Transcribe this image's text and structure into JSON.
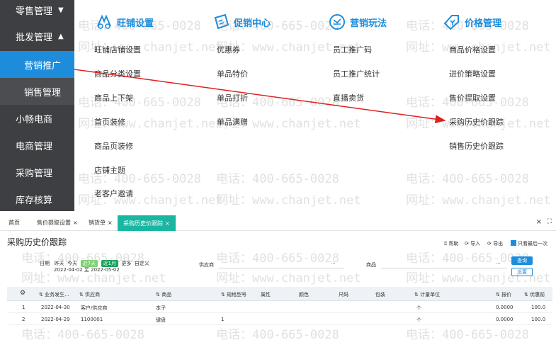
{
  "sidenav": {
    "items": [
      {
        "label": "零售管理",
        "caret": "▼"
      },
      {
        "label": "批发管理",
        "caret": "▲"
      },
      {
        "label": "营销推广",
        "caret": ""
      },
      {
        "label": "销售管理",
        "caret": ""
      },
      {
        "label": "小畅电商",
        "caret": ""
      },
      {
        "label": "电商管理",
        "caret": ""
      },
      {
        "label": "采购管理",
        "caret": ""
      },
      {
        "label": "库存核算",
        "caret": ""
      }
    ],
    "active_index": 2
  },
  "menu": {
    "columns": [
      {
        "title": "旺铺设置",
        "icon": "shop-settings-icon",
        "links": [
          "旺铺店铺设置",
          "商品分类设置",
          "商品上下架",
          "首页装修",
          "商品页装修",
          "店铺主题",
          "老客户邀请"
        ]
      },
      {
        "title": "促销中心",
        "icon": "coupon-icon",
        "links": [
          "优惠券",
          "单品特价",
          "单品打折",
          "单品满赠"
        ]
      },
      {
        "title": "营销玩法",
        "icon": "marketing-play-icon",
        "links": [
          "员工推广码",
          "员工推广统计",
          "直播卖货"
        ]
      },
      {
        "title": "价格管理",
        "icon": "price-tag-icon",
        "links": [
          "商品价格设置",
          "进价策略设置",
          "售价提取设置",
          "采购历史价跟踪",
          "销售历史价跟踪"
        ]
      }
    ]
  },
  "watermark": {
    "phone": "电话：400-665-0028",
    "site": "网址：www.chanjet.net"
  },
  "tabs": {
    "items": [
      {
        "label": "首页",
        "closable": false
      },
      {
        "label": "售价提取设置",
        "closable": true
      },
      {
        "label": "销货单",
        "closable": true
      },
      {
        "label": "采购历史价跟踪",
        "closable": true
      }
    ],
    "close_glyph": "×",
    "window_close": "×",
    "window_max": "⛶"
  },
  "page": {
    "title": "采购历史价跟踪",
    "toolbar": {
      "help": "帮助",
      "import": "导入",
      "export": "导出",
      "only_last": "只看最后一次"
    }
  },
  "filters": {
    "date_label": "日期",
    "quick": [
      "昨天",
      "今天",
      "近7天",
      "近1月",
      "更多",
      "自定义"
    ],
    "date_range": "2022-04-02 至 2022-05-02",
    "supplier_label": "供应商",
    "goods_label": "商品",
    "ellipsis": "···",
    "query_button": "查询",
    "settings_button": "设置"
  },
  "table": {
    "columns": [
      "业务发生...",
      "供应商",
      "商品",
      "规格型号",
      "属性",
      "颜色",
      "尺码",
      "包装",
      "计量单位",
      "报价",
      "优惠前"
    ],
    "settings_icon": "gear-icon",
    "rows": [
      {
        "no": "1",
        "date": "2022-04-30",
        "supplier": "客户/供应商",
        "goods": "本子",
        "spec": "",
        "unit": "个",
        "price": "0.0000",
        "pre": "100.0"
      },
      {
        "no": "2",
        "date": "2022-04-29",
        "supplier": "1100001",
        "goods": "键盘",
        "spec": "1",
        "unit": "个",
        "price": "0.0000",
        "pre": "100.0"
      }
    ]
  },
  "colors": {
    "nav_bg": "#3d3f42",
    "active_blue": "#1d8ddb",
    "active_tab": "#19b7a1",
    "arrow_red": "#e02020"
  }
}
